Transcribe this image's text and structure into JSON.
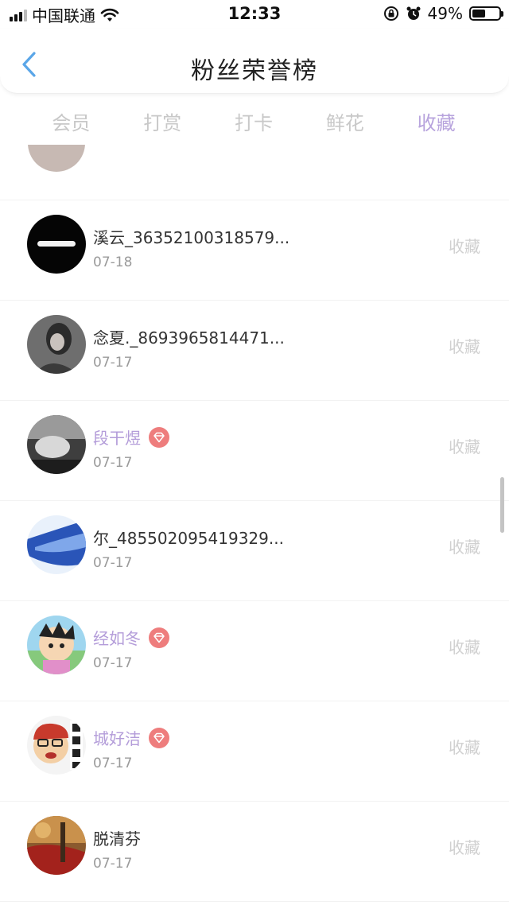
{
  "status_bar": {
    "carrier": "中国联通",
    "time": "12:33",
    "battery": "49%",
    "battery_level": 0.49,
    "icons": [
      "signal-icon",
      "wifi-icon",
      "rotation-lock-icon",
      "alarm-icon",
      "battery-icon"
    ]
  },
  "header": {
    "title": "粉丝荣誉榜",
    "back_icon": "chevron-left-icon",
    "accent_color": "#5aa6e8"
  },
  "tabs": [
    {
      "label": "会员",
      "active": false
    },
    {
      "label": "打赏",
      "active": false
    },
    {
      "label": "打卡",
      "active": false
    },
    {
      "label": "鲜花",
      "active": false
    },
    {
      "label": "收藏",
      "active": true
    }
  ],
  "colors": {
    "tab_active": "#b7a3dd",
    "vip_name": "#b39cd9",
    "badge": "#ee7d7d"
  },
  "fans": [
    {
      "name": "溪云_36352100318579...",
      "date": "07-18",
      "action": "收藏",
      "vip": false
    },
    {
      "name": "念夏._8693965814471...",
      "date": "07-17",
      "action": "收藏",
      "vip": false
    },
    {
      "name": "段干煜",
      "date": "07-17",
      "action": "收藏",
      "vip": true
    },
    {
      "name": "尔_485502095419329...",
      "date": "07-17",
      "action": "收藏",
      "vip": false
    },
    {
      "name": "经如冬",
      "date": "07-17",
      "action": "收藏",
      "vip": true
    },
    {
      "name": "城好洁",
      "date": "07-17",
      "action": "收藏",
      "vip": true
    },
    {
      "name": "脱清芬",
      "date": "07-17",
      "action": "收藏",
      "vip": false
    }
  ]
}
